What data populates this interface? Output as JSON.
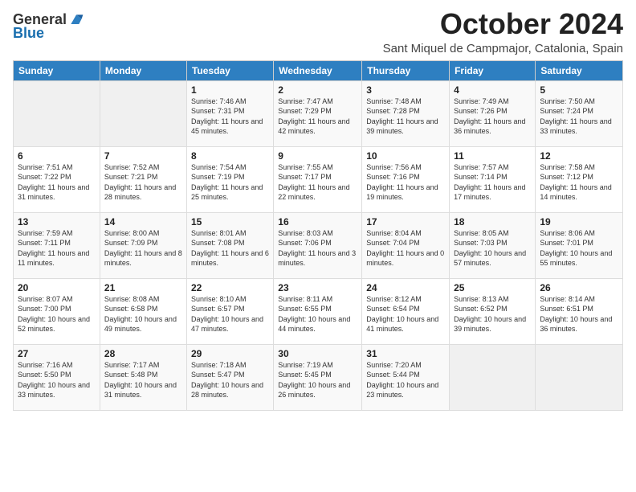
{
  "logo": {
    "general": "General",
    "blue": "Blue"
  },
  "title": "October 2024",
  "subtitle": "Sant Miquel de Campmajor, Catalonia, Spain",
  "days_of_week": [
    "Sunday",
    "Monday",
    "Tuesday",
    "Wednesday",
    "Thursday",
    "Friday",
    "Saturday"
  ],
  "weeks": [
    [
      {
        "day": "",
        "info": ""
      },
      {
        "day": "",
        "info": ""
      },
      {
        "day": "1",
        "info": "Sunrise: 7:46 AM\nSunset: 7:31 PM\nDaylight: 11 hours and 45 minutes."
      },
      {
        "day": "2",
        "info": "Sunrise: 7:47 AM\nSunset: 7:29 PM\nDaylight: 11 hours and 42 minutes."
      },
      {
        "day": "3",
        "info": "Sunrise: 7:48 AM\nSunset: 7:28 PM\nDaylight: 11 hours and 39 minutes."
      },
      {
        "day": "4",
        "info": "Sunrise: 7:49 AM\nSunset: 7:26 PM\nDaylight: 11 hours and 36 minutes."
      },
      {
        "day": "5",
        "info": "Sunrise: 7:50 AM\nSunset: 7:24 PM\nDaylight: 11 hours and 33 minutes."
      }
    ],
    [
      {
        "day": "6",
        "info": "Sunrise: 7:51 AM\nSunset: 7:22 PM\nDaylight: 11 hours and 31 minutes."
      },
      {
        "day": "7",
        "info": "Sunrise: 7:52 AM\nSunset: 7:21 PM\nDaylight: 11 hours and 28 minutes."
      },
      {
        "day": "8",
        "info": "Sunrise: 7:54 AM\nSunset: 7:19 PM\nDaylight: 11 hours and 25 minutes."
      },
      {
        "day": "9",
        "info": "Sunrise: 7:55 AM\nSunset: 7:17 PM\nDaylight: 11 hours and 22 minutes."
      },
      {
        "day": "10",
        "info": "Sunrise: 7:56 AM\nSunset: 7:16 PM\nDaylight: 11 hours and 19 minutes."
      },
      {
        "day": "11",
        "info": "Sunrise: 7:57 AM\nSunset: 7:14 PM\nDaylight: 11 hours and 17 minutes."
      },
      {
        "day": "12",
        "info": "Sunrise: 7:58 AM\nSunset: 7:12 PM\nDaylight: 11 hours and 14 minutes."
      }
    ],
    [
      {
        "day": "13",
        "info": "Sunrise: 7:59 AM\nSunset: 7:11 PM\nDaylight: 11 hours and 11 minutes."
      },
      {
        "day": "14",
        "info": "Sunrise: 8:00 AM\nSunset: 7:09 PM\nDaylight: 11 hours and 8 minutes."
      },
      {
        "day": "15",
        "info": "Sunrise: 8:01 AM\nSunset: 7:08 PM\nDaylight: 11 hours and 6 minutes."
      },
      {
        "day": "16",
        "info": "Sunrise: 8:03 AM\nSunset: 7:06 PM\nDaylight: 11 hours and 3 minutes."
      },
      {
        "day": "17",
        "info": "Sunrise: 8:04 AM\nSunset: 7:04 PM\nDaylight: 11 hours and 0 minutes."
      },
      {
        "day": "18",
        "info": "Sunrise: 8:05 AM\nSunset: 7:03 PM\nDaylight: 10 hours and 57 minutes."
      },
      {
        "day": "19",
        "info": "Sunrise: 8:06 AM\nSunset: 7:01 PM\nDaylight: 10 hours and 55 minutes."
      }
    ],
    [
      {
        "day": "20",
        "info": "Sunrise: 8:07 AM\nSunset: 7:00 PM\nDaylight: 10 hours and 52 minutes."
      },
      {
        "day": "21",
        "info": "Sunrise: 8:08 AM\nSunset: 6:58 PM\nDaylight: 10 hours and 49 minutes."
      },
      {
        "day": "22",
        "info": "Sunrise: 8:10 AM\nSunset: 6:57 PM\nDaylight: 10 hours and 47 minutes."
      },
      {
        "day": "23",
        "info": "Sunrise: 8:11 AM\nSunset: 6:55 PM\nDaylight: 10 hours and 44 minutes."
      },
      {
        "day": "24",
        "info": "Sunrise: 8:12 AM\nSunset: 6:54 PM\nDaylight: 10 hours and 41 minutes."
      },
      {
        "day": "25",
        "info": "Sunrise: 8:13 AM\nSunset: 6:52 PM\nDaylight: 10 hours and 39 minutes."
      },
      {
        "day": "26",
        "info": "Sunrise: 8:14 AM\nSunset: 6:51 PM\nDaylight: 10 hours and 36 minutes."
      }
    ],
    [
      {
        "day": "27",
        "info": "Sunrise: 7:16 AM\nSunset: 5:50 PM\nDaylight: 10 hours and 33 minutes."
      },
      {
        "day": "28",
        "info": "Sunrise: 7:17 AM\nSunset: 5:48 PM\nDaylight: 10 hours and 31 minutes."
      },
      {
        "day": "29",
        "info": "Sunrise: 7:18 AM\nSunset: 5:47 PM\nDaylight: 10 hours and 28 minutes."
      },
      {
        "day": "30",
        "info": "Sunrise: 7:19 AM\nSunset: 5:45 PM\nDaylight: 10 hours and 26 minutes."
      },
      {
        "day": "31",
        "info": "Sunrise: 7:20 AM\nSunset: 5:44 PM\nDaylight: 10 hours and 23 minutes."
      },
      {
        "day": "",
        "info": ""
      },
      {
        "day": "",
        "info": ""
      }
    ]
  ]
}
